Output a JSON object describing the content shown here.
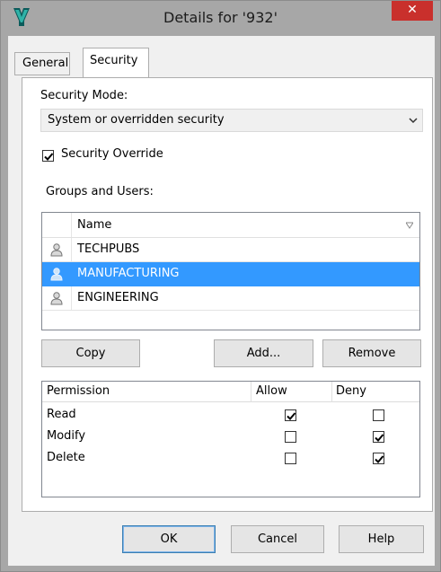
{
  "window": {
    "title": "Details for '932'",
    "close_glyph": "✕"
  },
  "tabs": [
    {
      "label": "General",
      "active": false
    },
    {
      "label": "Security",
      "active": true
    }
  ],
  "security": {
    "mode_label": "Security Mode:",
    "mode_value": "System or overridden security",
    "override_label": "Security Override",
    "override_checked": true,
    "groups_label": "Groups and Users:",
    "list_header": "Name",
    "list_items": [
      {
        "name": "TECHPUBS",
        "selected": false,
        "icon": "user-icon"
      },
      {
        "name": "MANUFACTURING",
        "selected": true,
        "icon": "user-icon"
      },
      {
        "name": "ENGINEERING",
        "selected": false,
        "icon": "user-icon"
      }
    ],
    "buttons": {
      "copy": "Copy",
      "add": "Add...",
      "remove": "Remove"
    },
    "permissions": {
      "headers": {
        "permission": "Permission",
        "allow": "Allow",
        "deny": "Deny"
      },
      "rows": [
        {
          "name": "Read",
          "allow": true,
          "deny": false
        },
        {
          "name": "Modify",
          "allow": false,
          "deny": true
        },
        {
          "name": "Delete",
          "allow": false,
          "deny": true
        }
      ]
    }
  },
  "footer": {
    "ok": "OK",
    "cancel": "Cancel",
    "help": "Help"
  },
  "colors": {
    "selection": "#3399ff",
    "close": "#c9302c",
    "chrome": "#a7a7a7"
  }
}
